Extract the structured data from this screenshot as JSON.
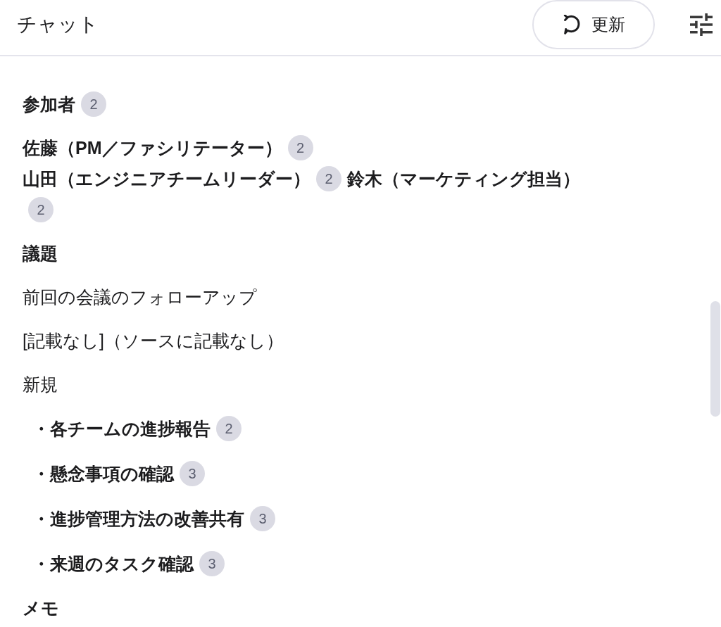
{
  "header": {
    "title": "チャット",
    "refresh_button": {
      "label": "更新"
    }
  },
  "blocks": [
    {
      "kind": "heading",
      "text": "参加者",
      "citation": "2"
    },
    {
      "kind": "participants",
      "lines": [
        [
          {
            "name": "佐藤（PM／ファシリテーター）",
            "citation": "2"
          }
        ],
        [
          {
            "name": "山田（エンジニアチームリーダー）",
            "citation": "2"
          },
          {
            "name": "鈴木（マーケティング担当）",
            "citation": "2"
          }
        ]
      ]
    },
    {
      "kind": "heading",
      "text": "議題"
    },
    {
      "kind": "paragraph",
      "text": "前回の会議のフォローアップ"
    },
    {
      "kind": "paragraph",
      "text": "[記載なし]（ソースに記載なし）"
    },
    {
      "kind": "paragraph",
      "text": "新規"
    },
    {
      "kind": "bullet",
      "text": "・各チームの進捗報告",
      "citation": "2"
    },
    {
      "kind": "bullet",
      "text": "・懸念事項の確認",
      "citation": "3"
    },
    {
      "kind": "bullet",
      "text": "・進捗管理方法の改善共有",
      "citation": "3"
    },
    {
      "kind": "bullet",
      "text": "・来週のタスク確認",
      "citation": "3"
    },
    {
      "kind": "heading",
      "text": "メモ"
    }
  ]
}
